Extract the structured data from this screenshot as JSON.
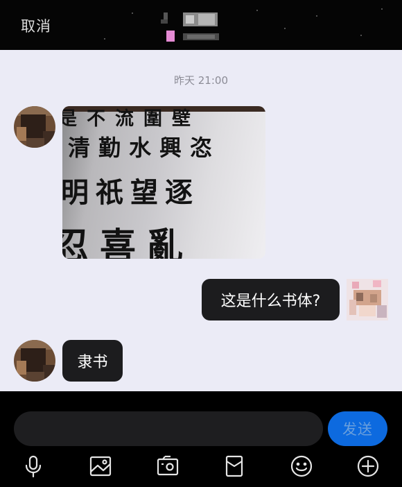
{
  "header": {
    "cancel_label": "取消",
    "contact_name_pixelated": true
  },
  "chat": {
    "timestamp": "昨天 21:00",
    "messages": [
      {
        "from": "contact",
        "type": "image",
        "image_text": [
          "是不流圍壁",
          "清勤水興恣",
          "明祇望逐",
          "忍喜亂"
        ]
      },
      {
        "from": "me",
        "type": "text",
        "text": "这是什么书体?"
      },
      {
        "from": "contact",
        "type": "text",
        "text": "隶书"
      }
    ]
  },
  "composer": {
    "input_value": "",
    "send_label": "发送"
  },
  "toolbar": {
    "icons": [
      "microphone-icon",
      "image-icon",
      "camera-icon",
      "red-envelope-icon",
      "emoji-icon",
      "plus-icon"
    ]
  },
  "colors": {
    "chat_bg": "#ebebf6",
    "bubble_bg": "#1c1c1e",
    "send_bg": "#0d6adf",
    "bar_bg": "#000000"
  }
}
